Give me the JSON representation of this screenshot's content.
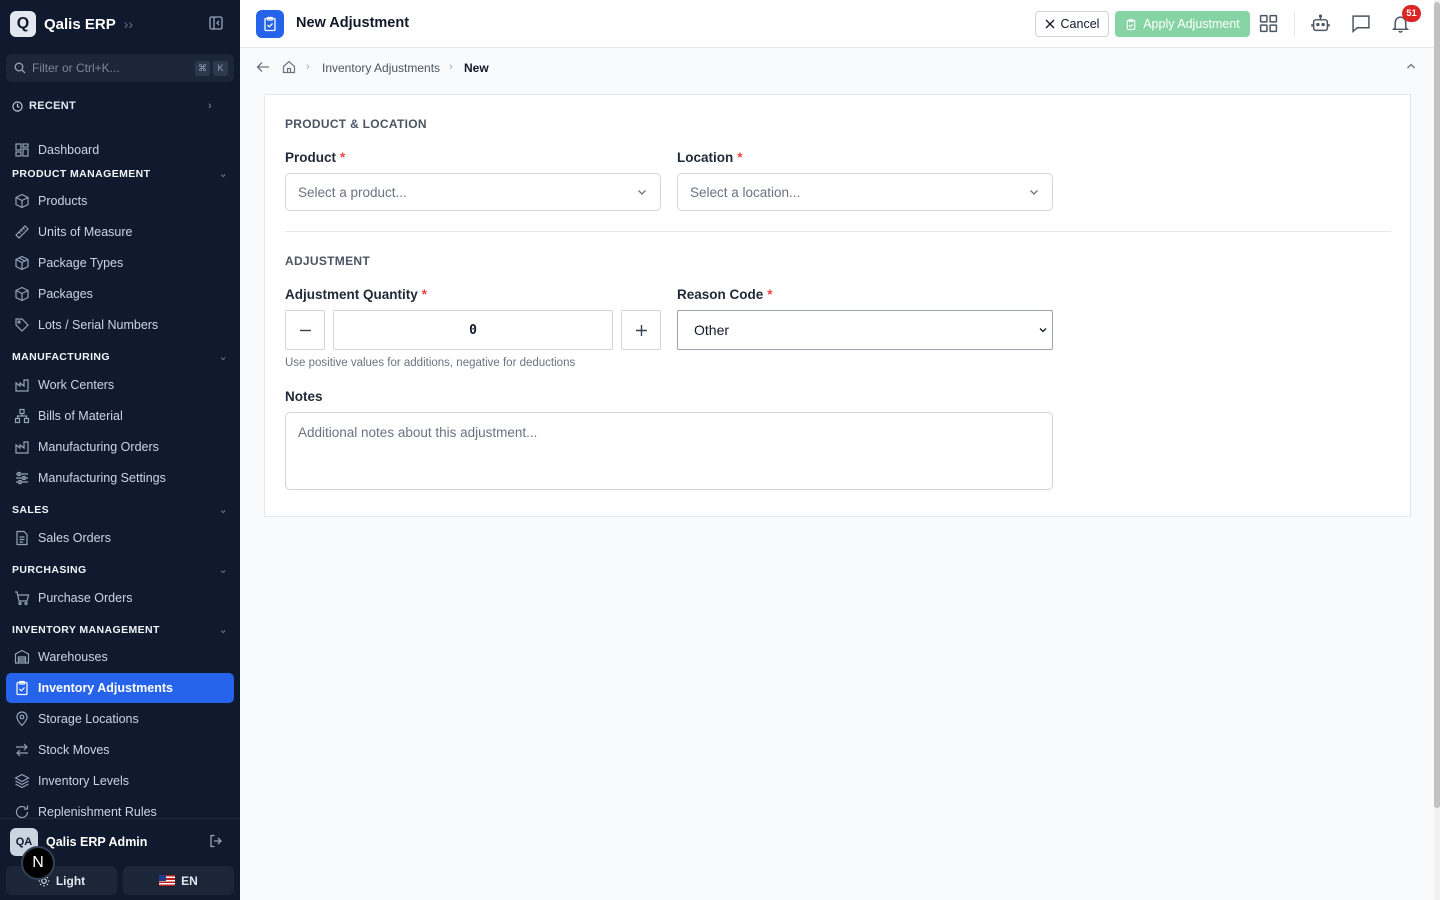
{
  "app": {
    "name": "Qalis ERP",
    "logo_letter": "Q"
  },
  "sidebar": {
    "filter_placeholder": "Filter or Ctrl+K...",
    "kbd_keys": [
      "⌘",
      "K"
    ],
    "recent_label": "RECENT",
    "dashboard": "Dashboard",
    "sections": {
      "product_management": "PRODUCT MANAGEMENT",
      "manufacturing": "MANUFACTURING",
      "sales": "SALES",
      "purchasing": "PURCHASING",
      "inventory_management": "INVENTORY MANAGEMENT"
    },
    "items": {
      "products": "Products",
      "units_of_measure": "Units of Measure",
      "package_types": "Package Types",
      "packages": "Packages",
      "lots_serial": "Lots / Serial Numbers",
      "work_centers": "Work Centers",
      "bills_of_material": "Bills of Material",
      "manufacturing_orders": "Manufacturing Orders",
      "manufacturing_settings": "Manufacturing Settings",
      "sales_orders": "Sales Orders",
      "purchase_orders": "Purchase Orders",
      "warehouses": "Warehouses",
      "inventory_adjustments": "Inventory Adjustments",
      "storage_locations": "Storage Locations",
      "stock_moves": "Stock Moves",
      "inventory_levels": "Inventory Levels",
      "replenishment_rules": "Replenishment Rules"
    },
    "user": {
      "initials": "QA",
      "name": "Qalis ERP Admin"
    },
    "theme_label": "Light",
    "lang_label": "EN",
    "floating_badge": "N"
  },
  "header": {
    "title": "New Adjustment",
    "cancel_label": "Cancel",
    "apply_label": "Apply Adjustment",
    "notification_count": "51"
  },
  "breadcrumb": {
    "parent": "Inventory Adjustments",
    "current": "New"
  },
  "form": {
    "section_product_location": "PRODUCT & LOCATION",
    "product_label": "Product",
    "product_placeholder": "Select a product...",
    "location_label": "Location",
    "location_placeholder": "Select a location...",
    "section_adjustment": "ADJUSTMENT",
    "quantity_label": "Adjustment Quantity",
    "quantity_value": "0",
    "quantity_hint": "Use positive values for additions, negative for deductions",
    "reason_label": "Reason Code",
    "reason_value": "Other",
    "notes_label": "Notes",
    "notes_placeholder": "Additional notes about this adjustment...",
    "required_marker": "*"
  },
  "colors": {
    "accent": "#2563eb",
    "sidebar_bg": "#0f1a2e",
    "apply_button": "#86d3a4",
    "required": "#ef4444",
    "badge": "#dc2626"
  },
  "icons": [
    "clipboard-check-icon",
    "x-icon",
    "grid-icon",
    "bot-icon",
    "chat-icon",
    "bell-icon",
    "home-icon",
    "arrow-left-icon",
    "chevron-down-icon",
    "minus-icon",
    "plus-icon"
  ]
}
